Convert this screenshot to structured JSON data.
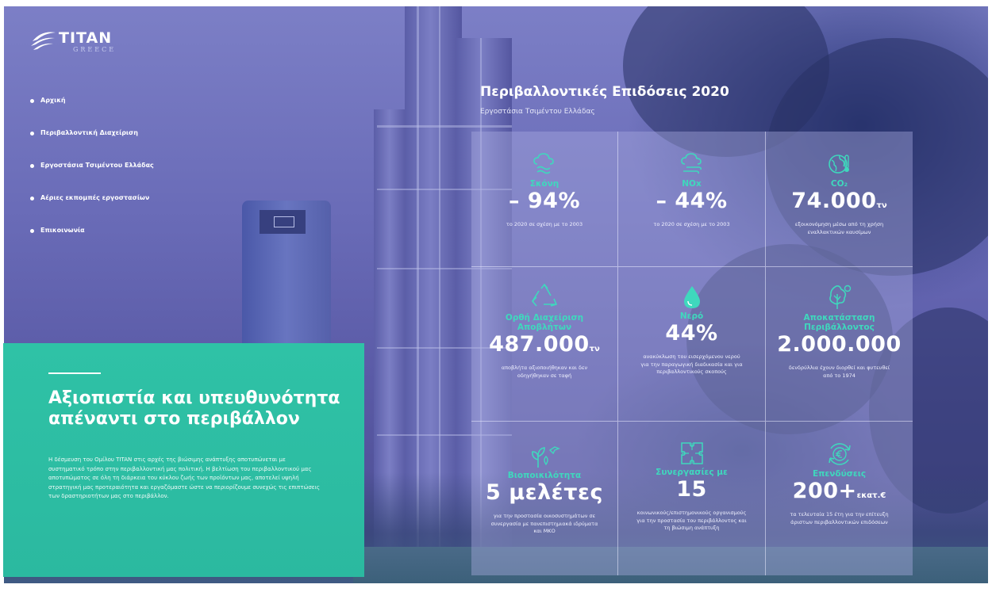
{
  "logo": {
    "name": "TITAN",
    "sub": "GREECE"
  },
  "nav": [
    "Αρχική",
    "Περιβαλλοντική Διαχείριση",
    "Εργοστάσια Τσιμέντου Ελλάδας",
    "Αέριες εκπομπές εργοστασίων",
    "Επικοινωνία"
  ],
  "panel": {
    "heading": "Αξιοπιστία και υπευθυνότητα απέναντι στο περιβάλλον",
    "text": "Η δέσμευση του Ομίλου TITAN στις αρχές της βιώσιμης ανάπτυξης αποτυπώνεται με συστηματικό τρόπο στην περιβαλλοντική μας πολιτική. Η βελτίωση του περιβαλλοντικού μας αποτυπώματος σε όλη τη διάρκεια του κύκλου ζωής των προϊόντων μας, αποτελεί υψηλή στρατηγική μας προτεραιότητα και εργαζόμαστε ώστε να περιορίζουμε συνεχώς τις επιπτώσεις των δραστηριοτήτων μας στο περιβάλλον."
  },
  "header": {
    "title": "Περιβαλλοντικές Επιδόσεις 2020",
    "subtitle": "Εργοστάσια Τσιμέντου Ελλάδας"
  },
  "stats": [
    {
      "icon": "cloud-dust-icon",
      "label": "Σκόνη",
      "value": "– 94%",
      "unit": "",
      "desc": "το 2020 σε σχέση με το 2003"
    },
    {
      "icon": "cloud-wind-icon",
      "label": "NOx",
      "value": "– 44%",
      "unit": "",
      "desc": "το 2020 σε σχέση με το 2003"
    },
    {
      "icon": "globe-thermometer-icon",
      "label": "CO₂",
      "value": "74.000",
      "unit": "τν",
      "desc": "εξοικονόμηση μέσω από τη χρήση εναλλακτικών καυσίμων"
    },
    {
      "icon": "recycle-icon",
      "label": "Ορθή Διαχείριση Αποβλήτων",
      "value": "487.000",
      "unit": "τν",
      "desc": "αποβλήτα αξιοποιήθηκαν και δεν οδηγήθηκαν σε ταφή"
    },
    {
      "icon": "water-drop-icon",
      "label": "Νερό",
      "value": "44%",
      "unit": "",
      "desc": "ανακύκλωση του εισερχόμενου νερού για την παραγωγική διαδικασία και για περιβαλλοντικούς σκοπούς"
    },
    {
      "icon": "tree-icon",
      "label": "Αποκατάσταση Περιβάλλοντος",
      "value": "2.000.000",
      "unit": "",
      "desc": "δενδρύλλια έχουν διορθεί και φυτευθεί από το 1974"
    },
    {
      "icon": "plant-bird-icon",
      "label": "Βιοποικιλότητα",
      "value": "5 μελέτες",
      "unit": "",
      "desc": "για την προστασία οικοσυστημάτων σε συνεργασία με πανεπιστημιακά ιδρύματα και ΜΚΟ"
    },
    {
      "icon": "puzzle-icon",
      "label": "Συνεργασίες με",
      "value": "15",
      "unit": "",
      "desc": "κοινωνικούς/επιστημονικούς οργανισμούς για την προστασία του περιβάλλοντος και τη βιώσιμη ανάπτυξη"
    },
    {
      "icon": "euro-cycle-icon",
      "label": "Επενδύσεις",
      "value": "200+",
      "unit": "εκατ.€",
      "desc": "τα τελευταία 15 έτη για την επίτευξη άριστων περιβαλλοντικών επιδόσεων"
    }
  ],
  "colors": {
    "accent": "#3fd8bd",
    "panel": "#2fc2a6",
    "overlay": "#6a6cb8"
  }
}
